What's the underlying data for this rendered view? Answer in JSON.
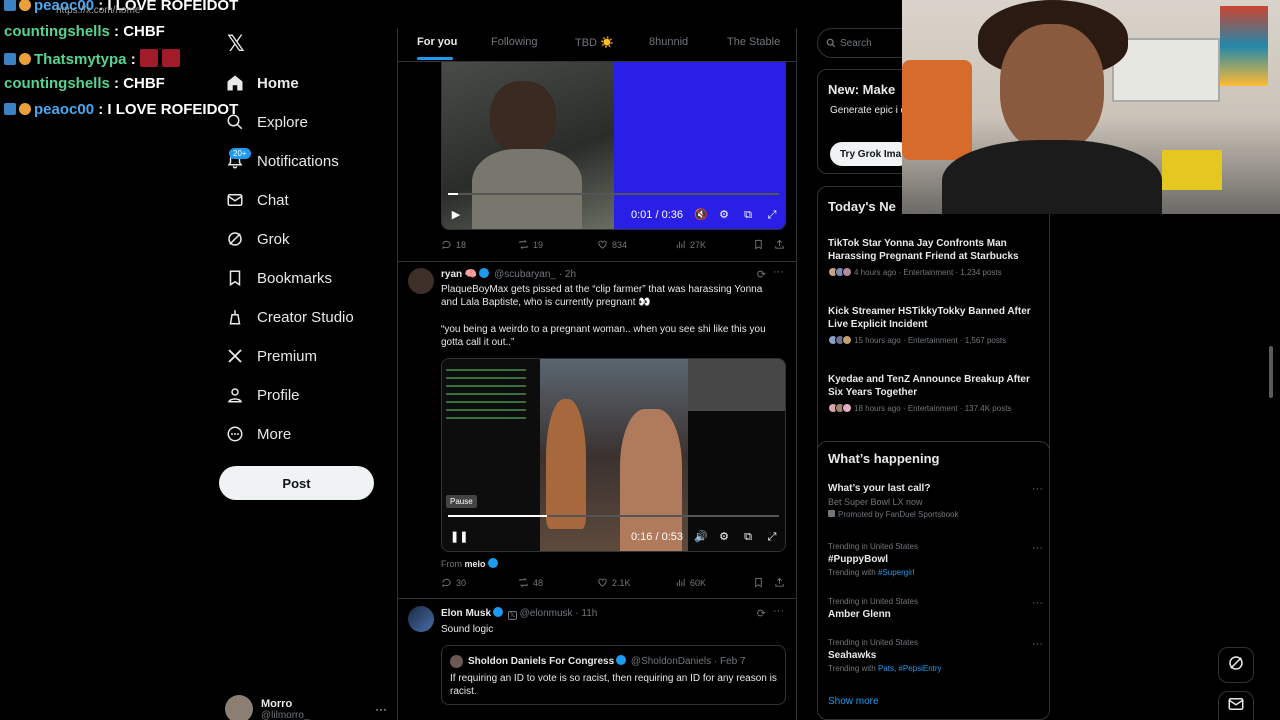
{
  "browser": {
    "url": "https://x.com/home"
  },
  "chat": [
    {
      "user": "peaoc00",
      "message": "I LOVE ROFEIDOT",
      "badges": 2,
      "color": "blue"
    },
    {
      "user": "countingshells",
      "message": "CHBF",
      "badges": 0,
      "color": "green"
    },
    {
      "user": "Thatsmytypa",
      "message": "",
      "badges": 2,
      "color": "green",
      "emotes": 2
    },
    {
      "user": "countingshells",
      "message": "CHBF",
      "badges": 0,
      "color": "green"
    },
    {
      "user": "peaoc00",
      "message": "I LOVE ROFEIDOT",
      "badges": 2,
      "color": "blue"
    }
  ],
  "nav": {
    "logo": "𝕏",
    "items": [
      {
        "label": "Home",
        "icon": "home-icon"
      },
      {
        "label": "Explore",
        "icon": "search-icon"
      },
      {
        "label": "Notifications",
        "icon": "bell-icon",
        "badge": "20+"
      },
      {
        "label": "Chat",
        "icon": "mail-icon"
      },
      {
        "label": "Grok",
        "icon": "grok-icon"
      },
      {
        "label": "Bookmarks",
        "icon": "bookmark-icon"
      },
      {
        "label": "Creator Studio",
        "icon": "creator-icon"
      },
      {
        "label": "Premium",
        "icon": "x-icon"
      },
      {
        "label": "Profile",
        "icon": "person-icon"
      },
      {
        "label": "More",
        "icon": "more-circle-icon"
      }
    ],
    "post_label": "Post",
    "account": {
      "name": "Morro",
      "handle": "@lilmorro_"
    }
  },
  "tabs": [
    "For you",
    "Following",
    "TBD ☀️",
    "8hunnid",
    "The Stable"
  ],
  "feed": {
    "tweet1": {
      "video": {
        "time": "0:01 / 0:36",
        "progress": 0.03
      },
      "stats": {
        "replies": "18",
        "reposts": "19",
        "likes": "834",
        "views": "27K"
      }
    },
    "tweet2": {
      "name": "ryan 🧠",
      "handle": "@scubaryan_",
      "age": "· 2h",
      "text1": "PlaqueBoyMax gets pissed at the “clip farmer” that was harassing Yonna and Lala Baptiste, who is currently pregnant 👀",
      "text2": "“you being a weirdo to a pregnant woman.. when you see shi like this you gotta call it out..”",
      "video": {
        "time": "0:16 / 0:53",
        "pause_tooltip": "Pause",
        "progress": 0.3
      },
      "from_label": "From",
      "from_name": "melo",
      "stats": {
        "replies": "30",
        "reposts": "48",
        "likes": "2.1K",
        "views": "60K"
      }
    },
    "tweet3": {
      "name": "Elon Musk",
      "handle": "@elonmusk",
      "age": "· 11h",
      "text": "Sound logic",
      "quote": {
        "name": "Sholdon Daniels For Congress",
        "handle": "@SholdonDaniels",
        "age": "· Feb 7",
        "text": "If requiring an ID to vote is so racist, then requiring an ID for any reason is racist."
      }
    }
  },
  "right": {
    "search_placeholder": "Search",
    "grok_card": {
      "title": "New: Make",
      "text": "Generate epic i quality.",
      "button": "Try Grok Ima"
    },
    "news_title": "Today's Ne",
    "news": [
      {
        "title": "TikTok Star Yonna Jay Confronts Man Harassing Pregnant Friend at Starbucks",
        "meta": "4 hours ago · Entertainment · 1,234 posts"
      },
      {
        "title": "Kick Streamer HSTikkyTokky Banned After Live Explicit Incident",
        "meta": "15 hours ago · Entertainment · 1,567 posts"
      },
      {
        "title": "Kyedae and TenZ Announce Breakup After Six Years Together",
        "meta": "18 hours ago · Entertainment · 137.4K posts"
      }
    ],
    "happening_title": "What’s happening",
    "trends": [
      {
        "cat": "",
        "name": "What’s your last call?",
        "sub": "Bet Super Bowl LX now",
        "promo": "Promoted by FanDuel Sportsbook"
      },
      {
        "cat": "Trending in United States",
        "name": "#PuppyBowl",
        "sub_prefix": "Trending with",
        "sub_links": "#Supergirl"
      },
      {
        "cat": "Trending in United States",
        "name": "Amber Glenn"
      },
      {
        "cat": "Trending in United States",
        "name": "Seahawks",
        "sub_prefix": "Trending with",
        "sub_links": "Pats, #PepsiEntry"
      }
    ],
    "show_more": "Show more"
  },
  "colors": {
    "accent": "#1d9bf0",
    "chat_green": "#57d38f",
    "chat_blue": "#4aa8f0",
    "border": "#2f3336",
    "muted": "#71767b"
  }
}
